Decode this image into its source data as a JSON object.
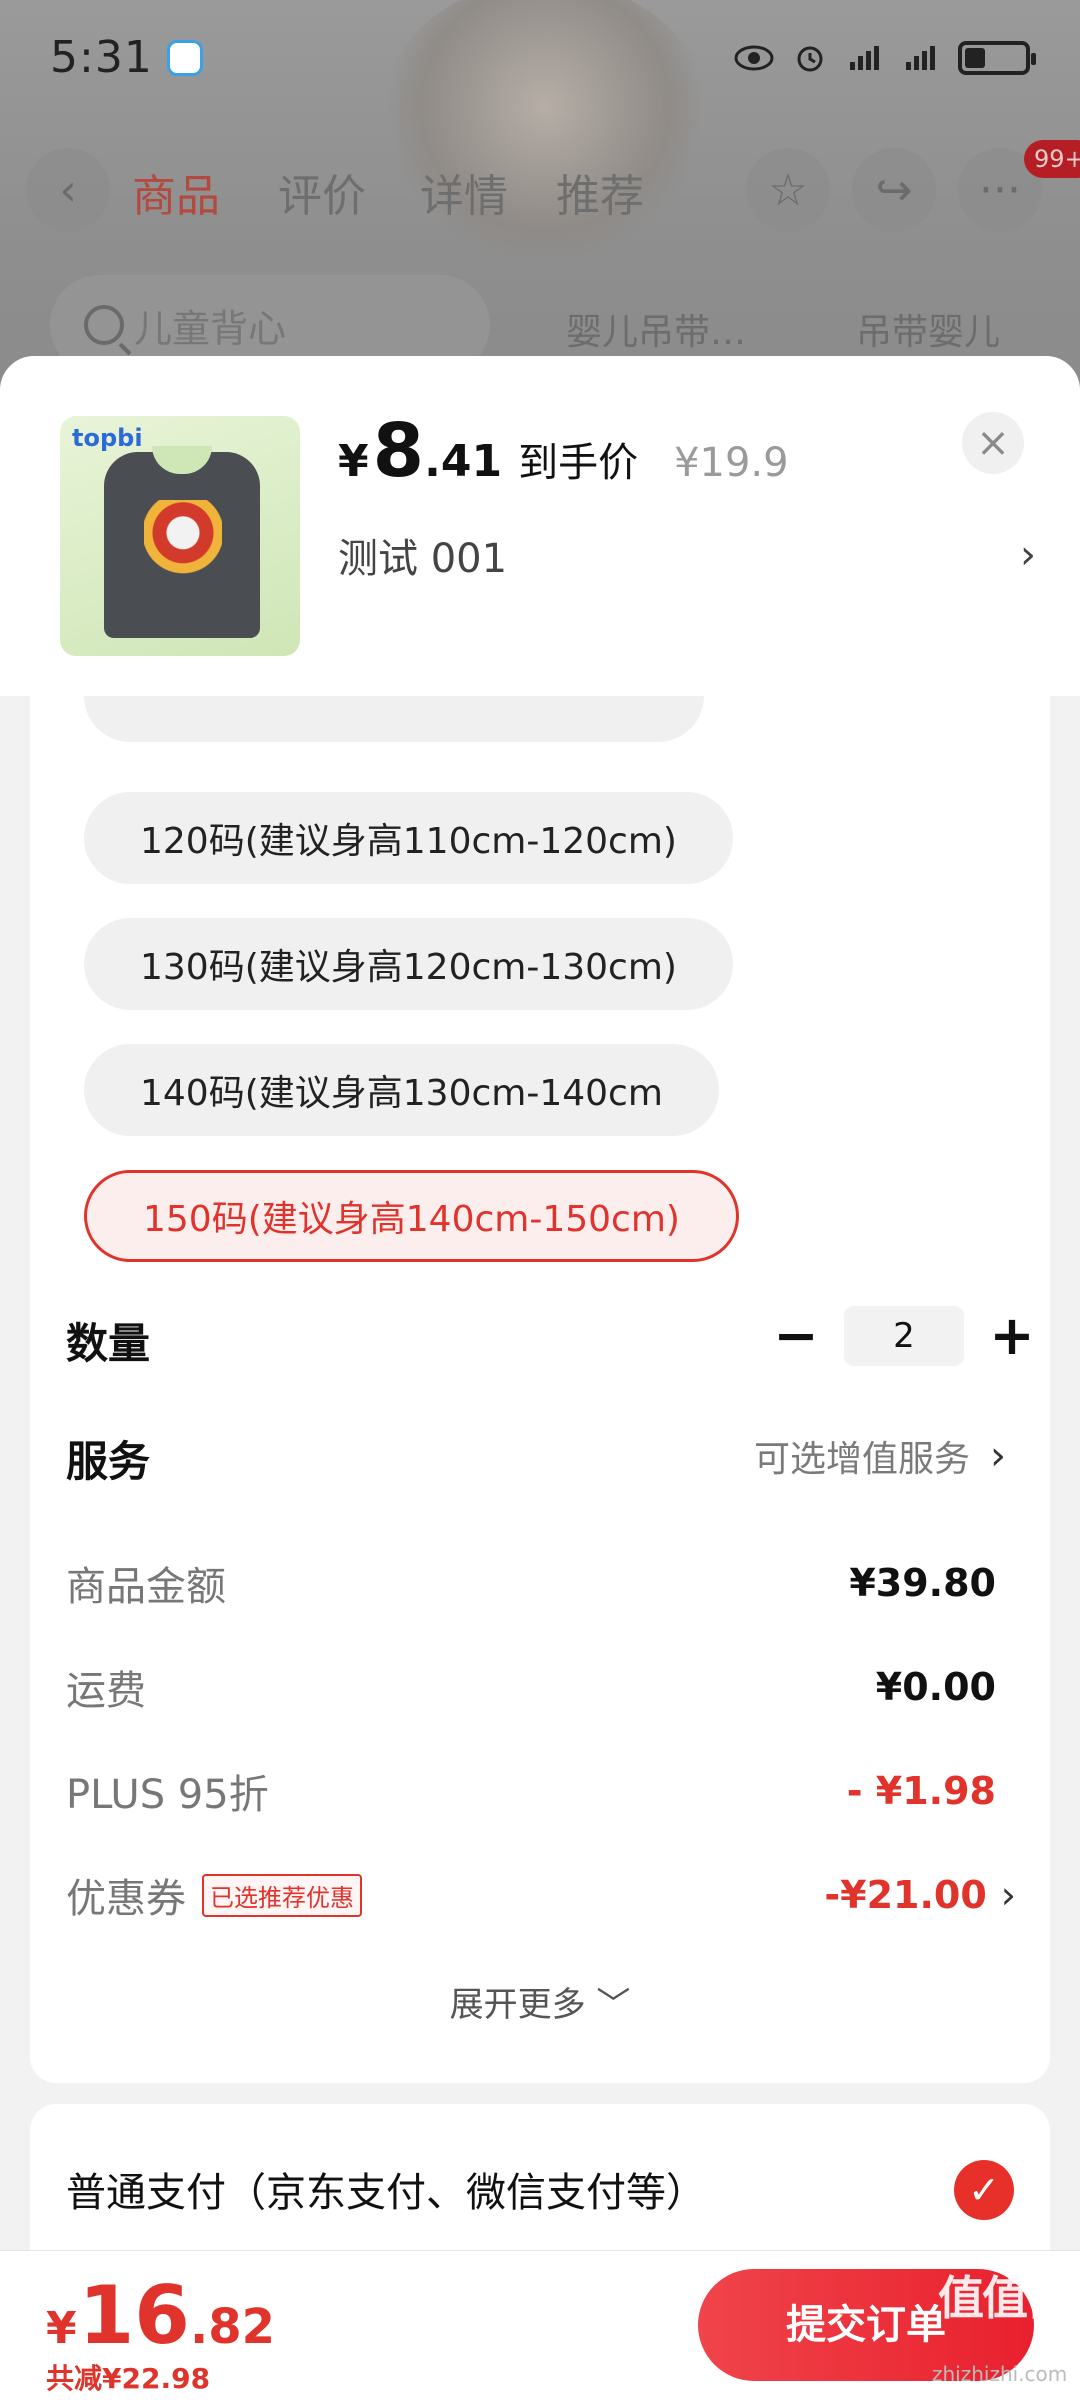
{
  "status_bar": {
    "time": "5:31"
  },
  "background": {
    "tabs": [
      "商品",
      "评价",
      "详情",
      "推荐"
    ],
    "badge": "99+",
    "search_placeholder": "儿童背心",
    "chips": [
      "婴儿吊带…",
      "吊带婴儿"
    ]
  },
  "header": {
    "thumb_logo": "topbi",
    "price_yen": "¥",
    "price_int": "8",
    "price_dec": ".41",
    "price_tag": "到手价",
    "original_price": "¥19.9",
    "close": "×",
    "spec": "测试  001",
    "spec_chevron": "›"
  },
  "sizes": [
    {
      "label": "120码(建议身高110cm-120cm)",
      "selected": false
    },
    {
      "label": "130码(建议身高120cm-130cm)",
      "selected": false
    },
    {
      "label": "140码(建议身高130cm-140cm",
      "selected": false
    },
    {
      "label": "150码(建议身高140cm-150cm)",
      "selected": true
    }
  ],
  "quantity": {
    "label": "数量",
    "minus": "−",
    "value": "2",
    "plus": "+"
  },
  "service": {
    "label": "服务",
    "value": "可选增值服务",
    "chevron": "›"
  },
  "price_detail": {
    "rows": [
      {
        "label": "商品金额",
        "value": "¥39.80"
      },
      {
        "label": "运费",
        "value": "¥0.00"
      },
      {
        "label": "PLUS 95折",
        "value": "- ¥1.98"
      },
      {
        "label": "优惠券",
        "tag": "已选推荐优惠",
        "value": "-¥21.00",
        "chevron": "›"
      }
    ],
    "expand": "展开更多 ﹀"
  },
  "payment": {
    "label": "普通支付（京东支付、微信支付等）",
    "check": "✓"
  },
  "bottom": {
    "total_yen": "¥",
    "total_int": "16",
    "total_dec": ".82",
    "saved": "共减¥22.98",
    "submit": "提交订单"
  },
  "watermark": {
    "text": "值值值",
    "url": "zhizhizhi.com"
  },
  "colors": {
    "accent": "#e0332c",
    "sheet_bg": "#f2f2f2",
    "card_bg": "#ffffff"
  }
}
